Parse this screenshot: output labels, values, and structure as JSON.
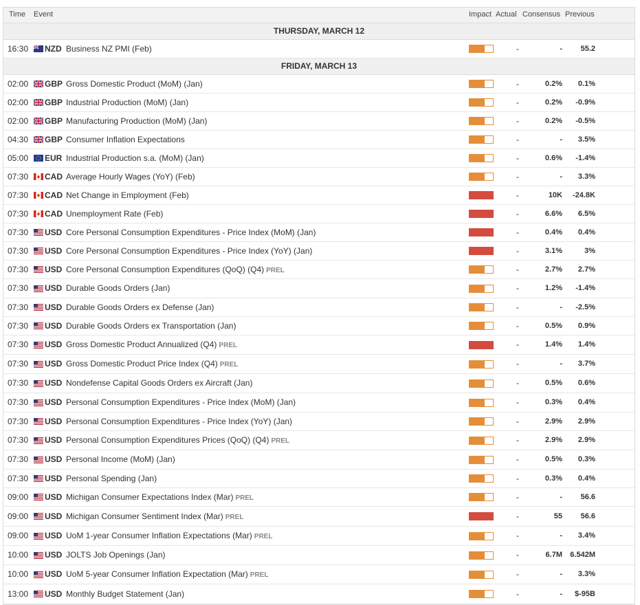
{
  "headers": {
    "time": "Time",
    "event": "Event",
    "impact": "Impact",
    "actual": "Actual",
    "consensus": "Consensus",
    "previous": "Previous"
  },
  "days": [
    {
      "label": "THURSDAY, MARCH 12",
      "rows": [
        {
          "time": "16:30",
          "flag": "nz",
          "currency": "NZD",
          "event": "Business NZ PMI (Feb)",
          "prel": "",
          "impact": "medium",
          "actual": "-",
          "consensus": "-",
          "previous": "55.2"
        }
      ]
    },
    {
      "label": "FRIDAY, MARCH 13",
      "rows": [
        {
          "time": "02:00",
          "flag": "gb",
          "currency": "GBP",
          "event": "Gross Domestic Product (MoM) (Jan)",
          "prel": "",
          "impact": "medium",
          "actual": "-",
          "consensus": "0.2%",
          "previous": "0.1%"
        },
        {
          "time": "02:00",
          "flag": "gb",
          "currency": "GBP",
          "event": "Industrial Production (MoM) (Jan)",
          "prel": "",
          "impact": "medium",
          "actual": "-",
          "consensus": "0.2%",
          "previous": "-0.9%"
        },
        {
          "time": "02:00",
          "flag": "gb",
          "currency": "GBP",
          "event": "Manufacturing Production (MoM) (Jan)",
          "prel": "",
          "impact": "medium",
          "actual": "-",
          "consensus": "0.2%",
          "previous": "-0.5%"
        },
        {
          "time": "04:30",
          "flag": "gb",
          "currency": "GBP",
          "event": "Consumer Inflation Expectations",
          "prel": "",
          "impact": "medium",
          "actual": "-",
          "consensus": "-",
          "previous": "3.5%"
        },
        {
          "time": "05:00",
          "flag": "eu",
          "currency": "EUR",
          "event": "Industrial Production s.a. (MoM) (Jan)",
          "prel": "",
          "impact": "medium",
          "actual": "-",
          "consensus": "0.6%",
          "previous": "-1.4%"
        },
        {
          "time": "07:30",
          "flag": "ca",
          "currency": "CAD",
          "event": "Average Hourly Wages (YoY) (Feb)",
          "prel": "",
          "impact": "medium",
          "actual": "-",
          "consensus": "-",
          "previous": "3.3%"
        },
        {
          "time": "07:30",
          "flag": "ca",
          "currency": "CAD",
          "event": "Net Change in Employment (Feb)",
          "prel": "",
          "impact": "high",
          "actual": "-",
          "consensus": "10K",
          "previous": "-24.8K"
        },
        {
          "time": "07:30",
          "flag": "ca",
          "currency": "CAD",
          "event": "Unemployment Rate (Feb)",
          "prel": "",
          "impact": "high",
          "actual": "-",
          "consensus": "6.6%",
          "previous": "6.5%"
        },
        {
          "time": "07:30",
          "flag": "us",
          "currency": "USD",
          "event": "Core Personal Consumption Expenditures - Price Index (MoM) (Jan)",
          "prel": "",
          "impact": "high",
          "actual": "-",
          "consensus": "0.4%",
          "previous": "0.4%"
        },
        {
          "time": "07:30",
          "flag": "us",
          "currency": "USD",
          "event": "Core Personal Consumption Expenditures - Price Index (YoY) (Jan)",
          "prel": "",
          "impact": "high",
          "actual": "-",
          "consensus": "3.1%",
          "previous": "3%"
        },
        {
          "time": "07:30",
          "flag": "us",
          "currency": "USD",
          "event": "Core Personal Consumption Expenditures (QoQ) (Q4)",
          "prel": "PREL",
          "impact": "medium",
          "actual": "-",
          "consensus": "2.7%",
          "previous": "2.7%"
        },
        {
          "time": "07:30",
          "flag": "us",
          "currency": "USD",
          "event": "Durable Goods Orders (Jan)",
          "prel": "",
          "impact": "medium",
          "actual": "-",
          "consensus": "1.2%",
          "previous": "-1.4%"
        },
        {
          "time": "07:30",
          "flag": "us",
          "currency": "USD",
          "event": "Durable Goods Orders ex Defense (Jan)",
          "prel": "",
          "impact": "medium",
          "actual": "-",
          "consensus": "-",
          "previous": "-2.5%"
        },
        {
          "time": "07:30",
          "flag": "us",
          "currency": "USD",
          "event": "Durable Goods Orders ex Transportation (Jan)",
          "prel": "",
          "impact": "medium",
          "actual": "-",
          "consensus": "0.5%",
          "previous": "0.9%"
        },
        {
          "time": "07:30",
          "flag": "us",
          "currency": "USD",
          "event": "Gross Domestic Product Annualized (Q4)",
          "prel": "PREL",
          "impact": "high",
          "actual": "-",
          "consensus": "1.4%",
          "previous": "1.4%"
        },
        {
          "time": "07:30",
          "flag": "us",
          "currency": "USD",
          "event": "Gross Domestic Product Price Index (Q4)",
          "prel": "PREL",
          "impact": "medium",
          "actual": "-",
          "consensus": "-",
          "previous": "3.7%"
        },
        {
          "time": "07:30",
          "flag": "us",
          "currency": "USD",
          "event": "Nondefense Capital Goods Orders ex Aircraft (Jan)",
          "prel": "",
          "impact": "medium",
          "actual": "-",
          "consensus": "0.5%",
          "previous": "0.6%"
        },
        {
          "time": "07:30",
          "flag": "us",
          "currency": "USD",
          "event": "Personal Consumption Expenditures - Price Index (MoM) (Jan)",
          "prel": "",
          "impact": "medium",
          "actual": "-",
          "consensus": "0.3%",
          "previous": "0.4%"
        },
        {
          "time": "07:30",
          "flag": "us",
          "currency": "USD",
          "event": "Personal Consumption Expenditures - Price Index (YoY) (Jan)",
          "prel": "",
          "impact": "medium",
          "actual": "-",
          "consensus": "2.9%",
          "previous": "2.9%"
        },
        {
          "time": "07:30",
          "flag": "us",
          "currency": "USD",
          "event": "Personal Consumption Expenditures Prices (QoQ) (Q4)",
          "prel": "PREL",
          "impact": "medium",
          "actual": "-",
          "consensus": "2.9%",
          "previous": "2.9%"
        },
        {
          "time": "07:30",
          "flag": "us",
          "currency": "USD",
          "event": "Personal Income (MoM) (Jan)",
          "prel": "",
          "impact": "medium",
          "actual": "-",
          "consensus": "0.5%",
          "previous": "0.3%"
        },
        {
          "time": "07:30",
          "flag": "us",
          "currency": "USD",
          "event": "Personal Spending (Jan)",
          "prel": "",
          "impact": "medium",
          "actual": "-",
          "consensus": "0.3%",
          "previous": "0.4%"
        },
        {
          "time": "09:00",
          "flag": "us",
          "currency": "USD",
          "event": "Michigan Consumer Expectations Index (Mar)",
          "prel": "PREL",
          "impact": "medium",
          "actual": "-",
          "consensus": "-",
          "previous": "56.6"
        },
        {
          "time": "09:00",
          "flag": "us",
          "currency": "USD",
          "event": "Michigan Consumer Sentiment Index (Mar)",
          "prel": "PREL",
          "impact": "high",
          "actual": "-",
          "consensus": "55",
          "previous": "56.6"
        },
        {
          "time": "09:00",
          "flag": "us",
          "currency": "USD",
          "event": "UoM 1-year Consumer Inflation Expectations (Mar)",
          "prel": "PREL",
          "impact": "medium",
          "actual": "-",
          "consensus": "-",
          "previous": "3.4%"
        },
        {
          "time": "10:00",
          "flag": "us",
          "currency": "USD",
          "event": "JOLTS Job Openings (Jan)",
          "prel": "",
          "impact": "medium",
          "actual": "-",
          "consensus": "6.7M",
          "previous": "6.542M"
        },
        {
          "time": "10:00",
          "flag": "us",
          "currency": "USD",
          "event": "UoM 5-year Consumer Inflation Expectation (Mar)",
          "prel": "PREL",
          "impact": "medium",
          "actual": "-",
          "consensus": "-",
          "previous": "3.3%"
        },
        {
          "time": "13:00",
          "flag": "us",
          "currency": "USD",
          "event": "Monthly Budget Statement (Jan)",
          "prel": "",
          "impact": "medium",
          "actual": "-",
          "consensus": "-",
          "previous": "$-95B"
        }
      ]
    }
  ],
  "impact_levels": {
    "medium": 0.66,
    "high": 1.0
  },
  "colors": {
    "medium": "#e58e3a",
    "high": "#d44c40"
  }
}
